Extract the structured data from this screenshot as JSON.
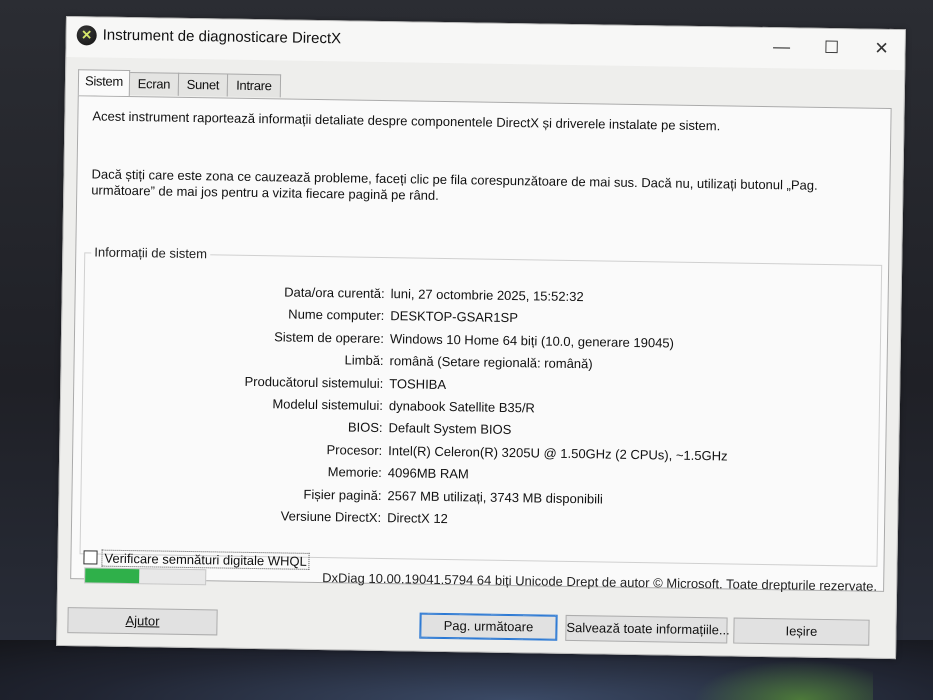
{
  "window": {
    "title": "Instrument de diagnosticare DirectX",
    "icon": "directx-x-icon",
    "controls": {
      "minimize": "—",
      "maximize": "☐",
      "close": "✕"
    }
  },
  "tabs": [
    {
      "label": "Sistem",
      "active": true
    },
    {
      "label": "Ecran",
      "active": false
    },
    {
      "label": "Sunet",
      "active": false
    },
    {
      "label": "Intrare",
      "active": false
    }
  ],
  "intro": {
    "line1": "Acest instrument raportează informații detaliate despre componentele DirectX și driverele instalate pe sistem.",
    "line2": "Dacă știți care este zona ce cauzează probleme, faceți clic pe fila corespunzătoare de mai sus. Dacă nu, utilizați butonul „Pag. următoare” de mai jos pentru a vizita fiecare pagină pe rând."
  },
  "system_info": {
    "group_title": "Informații de sistem",
    "rows": [
      {
        "label": "Data/ora curentă:",
        "value": "luni, 27 octombrie 2025, 15:52:32"
      },
      {
        "label": "Nume computer:",
        "value": "DESKTOP-GSAR1SP"
      },
      {
        "label": "Sistem de operare:",
        "value": "Windows 10 Home 64 biți (10.0, generare 19045)"
      },
      {
        "label": "Limbă:",
        "value": "română (Setare regională: română)"
      },
      {
        "label": "Producătorul sistemului:",
        "value": "TOSHIBA"
      },
      {
        "label": "Modelul sistemului:",
        "value": "dynabook Satellite B35/R"
      },
      {
        "label": "BIOS:",
        "value": "Default System BIOS"
      },
      {
        "label": "Procesor:",
        "value": "Intel(R) Celeron(R) 3205U @ 1.50GHz (2 CPUs), ~1.5GHz"
      },
      {
        "label": "Memorie:",
        "value": "4096MB RAM"
      },
      {
        "label": "Fișier pagină:",
        "value": "2567 MB utilizați, 3743 MB disponibili"
      },
      {
        "label": "Versiune DirectX:",
        "value": "DirectX 12"
      }
    ]
  },
  "whql_checkbox": {
    "label": "Verificare semnături digitale WHQL",
    "checked": false
  },
  "progress": {
    "fraction": 0.45,
    "color": "#2fb04a"
  },
  "footer_text": "DxDiag 10.00.19041.5794 64 biți Unicode  Drept de autor © Microsoft. Toate drepturile rezervate.",
  "buttons": {
    "help": "Ajutor",
    "next_page": "Pag. următoare",
    "save_all": "Salvează toate informațiile...",
    "exit": "Ieșire"
  }
}
